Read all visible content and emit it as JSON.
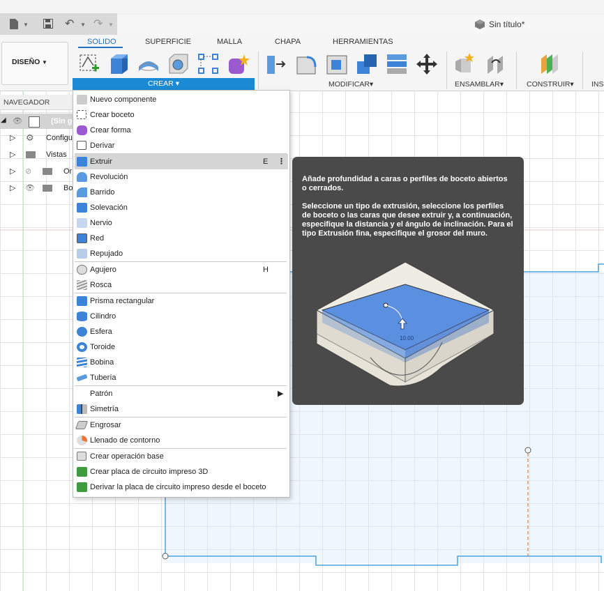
{
  "window": {
    "title": "Sin título*"
  },
  "ribbon": {
    "workspace": "DISEÑO",
    "tabs": [
      "SOLIDO",
      "SUPERFICIE",
      "MALLA",
      "CHAPA",
      "HERRAMIENTAS"
    ],
    "active_tab": "SOLIDO",
    "groups": {
      "crear": "CREAR",
      "modificar": "MODIFICAR",
      "ensamblar": "ENSAMBLAR",
      "construir": "CONSTRUIR",
      "insertar": "INS"
    }
  },
  "navigator": {
    "header": "NAVEGADOR",
    "items": [
      {
        "label": "(Sin g"
      },
      {
        "label": "Configu"
      },
      {
        "label": "Vistas g"
      },
      {
        "label": "Or"
      },
      {
        "label": "Bo"
      }
    ]
  },
  "menu": {
    "items": [
      {
        "label": "Nuevo componente"
      },
      {
        "label": "Crear boceto"
      },
      {
        "label": "Crear forma"
      },
      {
        "label": "Derivar"
      },
      {
        "label": "Extruir",
        "shortcut": "E"
      },
      {
        "label": "Revolución"
      },
      {
        "label": "Barrido"
      },
      {
        "label": "Solevación"
      },
      {
        "label": "Nervio"
      },
      {
        "label": "Red"
      },
      {
        "label": "Repujado"
      },
      {
        "label": "Agujero",
        "shortcut": "H"
      },
      {
        "label": "Rosca"
      },
      {
        "label": "Prisma rectangular"
      },
      {
        "label": "Cilindro"
      },
      {
        "label": "Esfera"
      },
      {
        "label": "Toroide"
      },
      {
        "label": "Bobina"
      },
      {
        "label": "Tubería"
      },
      {
        "label": "Patrón"
      },
      {
        "label": "Simetría"
      },
      {
        "label": "Engrosar"
      },
      {
        "label": "Llenado de contorno"
      },
      {
        "label": "Crear operación base"
      },
      {
        "label": "Crear placa de circuito impreso 3D"
      },
      {
        "label": "Derivar la placa de circuito impreso desde el boceto"
      }
    ]
  },
  "tooltip": {
    "paragraph1": "Añade profundidad a caras o perfiles de boceto abiertos o cerrados.",
    "paragraph2": "Seleccione un tipo de extrusión, seleccione los perfiles de boceto o las caras que desee extruir y, a continuación, especifique la distancia y el ángulo de inclinación. Para el tipo Extrusión fina, especifique el grosor del muro.",
    "illustration_value": "10.00"
  },
  "colors": {
    "accent": "#1a8ad4",
    "sketch_line": "#4aa3df",
    "tooltip_bg": "#4a4a4a",
    "extrude_blue": "#5b8fe0"
  }
}
